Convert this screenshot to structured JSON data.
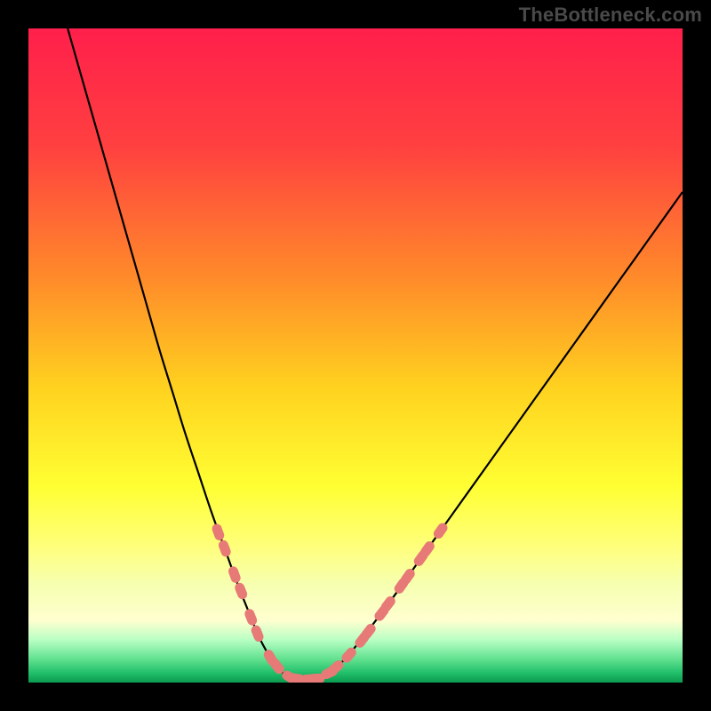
{
  "watermark": "TheBottleneck.com",
  "colors": {
    "frame": "#000000",
    "watermark_text": "#4a4a4a",
    "curve": "#000000",
    "markers": "#e77a77",
    "gradient_stops": [
      {
        "offset": 0.0,
        "color": "#ff1f4b"
      },
      {
        "offset": 0.18,
        "color": "#ff4040"
      },
      {
        "offset": 0.38,
        "color": "#ff8a2a"
      },
      {
        "offset": 0.55,
        "color": "#ffd21f"
      },
      {
        "offset": 0.7,
        "color": "#ffff33"
      },
      {
        "offset": 0.79,
        "color": "#ffff7a"
      },
      {
        "offset": 0.85,
        "color": "#f6ffb0"
      },
      {
        "offset": 0.905,
        "color": "#ffffcf"
      },
      {
        "offset": 0.935,
        "color": "#b8ffc4"
      },
      {
        "offset": 0.965,
        "color": "#5fe08e"
      },
      {
        "offset": 0.985,
        "color": "#22c06b"
      },
      {
        "offset": 1.0,
        "color": "#0a9a4f"
      }
    ]
  },
  "chart_data": {
    "type": "line",
    "title": "",
    "xlabel": "",
    "ylabel": "",
    "xlim": [
      0,
      100
    ],
    "ylim": [
      0,
      100
    ],
    "grid": false,
    "legend": false,
    "series": [
      {
        "name": "bottleneck-curve",
        "x": [
          6,
          8,
          10,
          12,
          14,
          16,
          18,
          20,
          22,
          24,
          26,
          28,
          30,
          32,
          34,
          35,
          36,
          37,
          38,
          39,
          40,
          42,
          44,
          46,
          48,
          50,
          55,
          60,
          65,
          70,
          75,
          80,
          85,
          90,
          95,
          100
        ],
        "y": [
          100,
          93,
          86,
          79,
          72,
          65,
          58,
          51,
          44.5,
          38,
          32,
          26,
          20.5,
          15,
          10,
          7.5,
          5.5,
          3.8,
          2.5,
          1.4,
          0.8,
          0.5,
          0.6,
          1.5,
          3.2,
          5.5,
          12,
          19,
          26,
          33,
          40,
          47,
          54,
          61,
          68,
          75
        ]
      }
    ],
    "markers": {
      "name": "highlighted-points",
      "points": [
        {
          "x": 29,
          "y": 23
        },
        {
          "x": 30,
          "y": 20.5
        },
        {
          "x": 31.5,
          "y": 16.5
        },
        {
          "x": 32.5,
          "y": 14
        },
        {
          "x": 34,
          "y": 10
        },
        {
          "x": 35,
          "y": 7.5
        },
        {
          "x": 37,
          "y": 3.8
        },
        {
          "x": 38,
          "y": 2.5
        },
        {
          "x": 40,
          "y": 0.8
        },
        {
          "x": 41,
          "y": 0.6
        },
        {
          "x": 43,
          "y": 0.5
        },
        {
          "x": 44,
          "y": 0.6
        },
        {
          "x": 46,
          "y": 1.5
        },
        {
          "x": 47,
          "y": 2.3
        },
        {
          "x": 49,
          "y": 4.2
        },
        {
          "x": 51,
          "y": 6.5
        },
        {
          "x": 52,
          "y": 7.8
        },
        {
          "x": 54,
          "y": 10.6
        },
        {
          "x": 55,
          "y": 12
        },
        {
          "x": 57,
          "y": 14.8
        },
        {
          "x": 58,
          "y": 16.2
        },
        {
          "x": 60,
          "y": 19
        },
        {
          "x": 61,
          "y": 20.4
        },
        {
          "x": 63,
          "y": 23.2
        }
      ]
    }
  }
}
